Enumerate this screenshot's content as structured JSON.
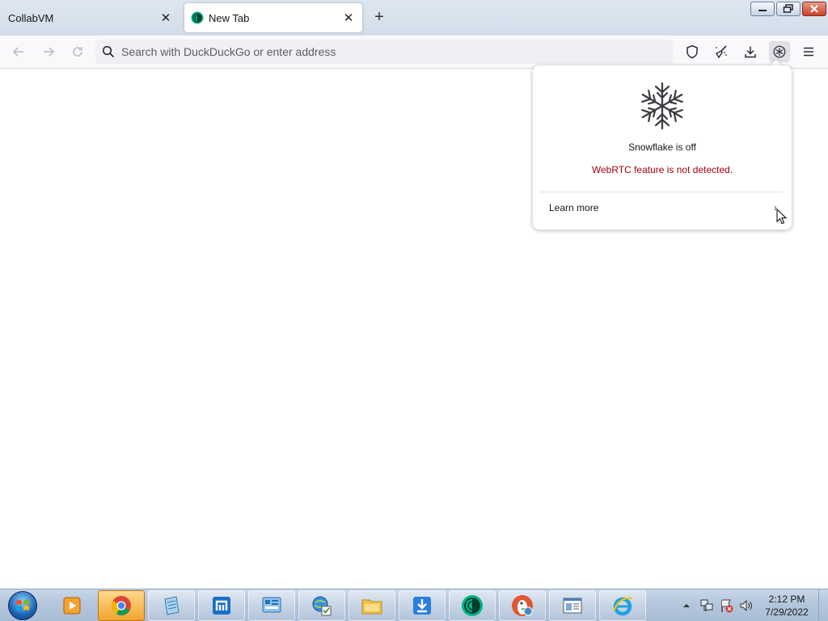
{
  "tabs": [
    {
      "label": "CollabVM",
      "active": false
    },
    {
      "label": "New Tab",
      "active": true
    }
  ],
  "new_tab_symbol": "+",
  "close_symbol": "✕",
  "window_controls": [
    "minimize-icon",
    "restore-icon",
    "close-icon"
  ],
  "navbar": {
    "back_icon": "back-arrow-icon",
    "forward_icon": "forward-arrow-icon",
    "reload_icon": "reload-icon",
    "search_icon": "search-icon",
    "url_placeholder": "Search with DuckDuckGo or enter address",
    "url_value": "",
    "toolbar_icons": [
      "shield-icon",
      "broom-icon",
      "download-icon",
      "snowflake-icon",
      "menu-icon"
    ]
  },
  "snowflake_popup": {
    "title": "Snowflake is off",
    "warning": "WebRTC feature is not detected.",
    "learn_more": "Learn more",
    "chevron": "›",
    "warning_color": "#a4000f"
  },
  "taskbar": {
    "apps": [
      "windows-media-player-icon",
      "chrome-icon",
      "notepad-icon",
      "maxthon-icon",
      "control-panel-icon",
      "internet-options-icon",
      "folder-icon",
      "download-manager-icon",
      "tor-browser-icon",
      "duckduckgo-icon",
      "document-viewer-icon",
      "internet-explorer-icon"
    ],
    "active_app": "chrome-icon",
    "tray_icons": [
      "show-hidden-icon",
      "network-icon",
      "action-center-icon",
      "volume-icon"
    ],
    "clock": {
      "time": "2:12 PM",
      "date": "7/29/2022"
    }
  },
  "colors": {
    "tabstrip_bg": "#d3dde9",
    "toolbar_bg": "#f9f9fb",
    "urlbar_bg": "#f0f0f4",
    "accent_green": "#00b589"
  }
}
